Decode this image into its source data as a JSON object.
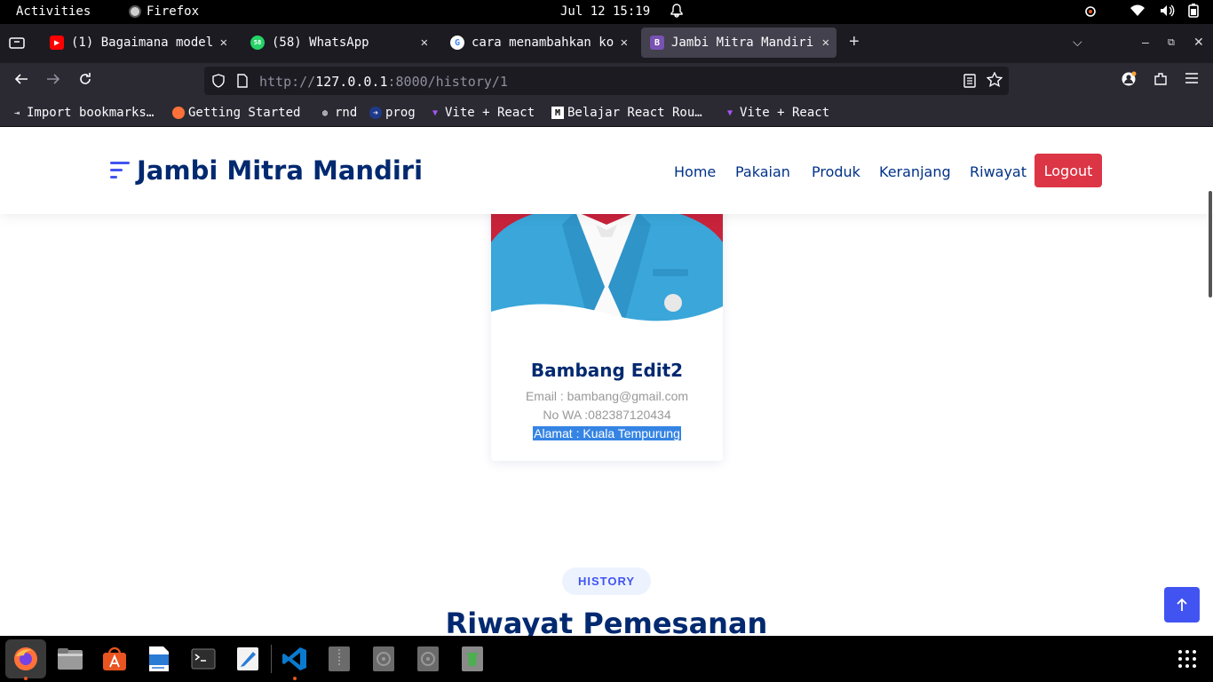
{
  "system_bar": {
    "activities": "Activities",
    "app": "Firefox",
    "clock": "Jul 12  15:19"
  },
  "tabs": [
    {
      "title": "(1) Bagaimana model",
      "favicon": "youtube-icon",
      "color": "#ff0000"
    },
    {
      "title": "(58) WhatsApp",
      "favicon": "whatsapp-icon",
      "color": "#25d366"
    },
    {
      "title": "cara menambahkan ko",
      "favicon": "google-icon",
      "color": "#4285f4"
    },
    {
      "title": "Jambi Mitra Mandiri",
      "favicon": "bootstrap-icon",
      "color": "#7952b3",
      "active": true
    }
  ],
  "url": {
    "scheme": "http://",
    "host": "127.0.0.1",
    "rest": ":8000/history/1"
  },
  "bookmarks": [
    {
      "label": "Import bookmarks…"
    },
    {
      "label": "Getting Started"
    },
    {
      "label": "rnd"
    },
    {
      "label": "prog"
    },
    {
      "label": "Vite + React"
    },
    {
      "label": "Belajar React Rou…"
    },
    {
      "label": "Vite + React"
    }
  ],
  "site": {
    "brand": "Jambi Mitra Mandiri",
    "menu": [
      "Home",
      "Pakaian",
      "Produk",
      "Keranjang",
      "Riwayat"
    ],
    "logout": "Logout"
  },
  "profile": {
    "name": "Bambang Edit2",
    "email": "Email : bambang@gmail.com",
    "wa": "No WA :082387120434",
    "address": "Alamat : Kuala Tempurung"
  },
  "section": {
    "badge": "HISTORY",
    "title": "Riwayat Pemesanan"
  },
  "colors": {
    "accent": "#4154f1",
    "brand_text": "#012970",
    "logout": "#dc3545"
  }
}
